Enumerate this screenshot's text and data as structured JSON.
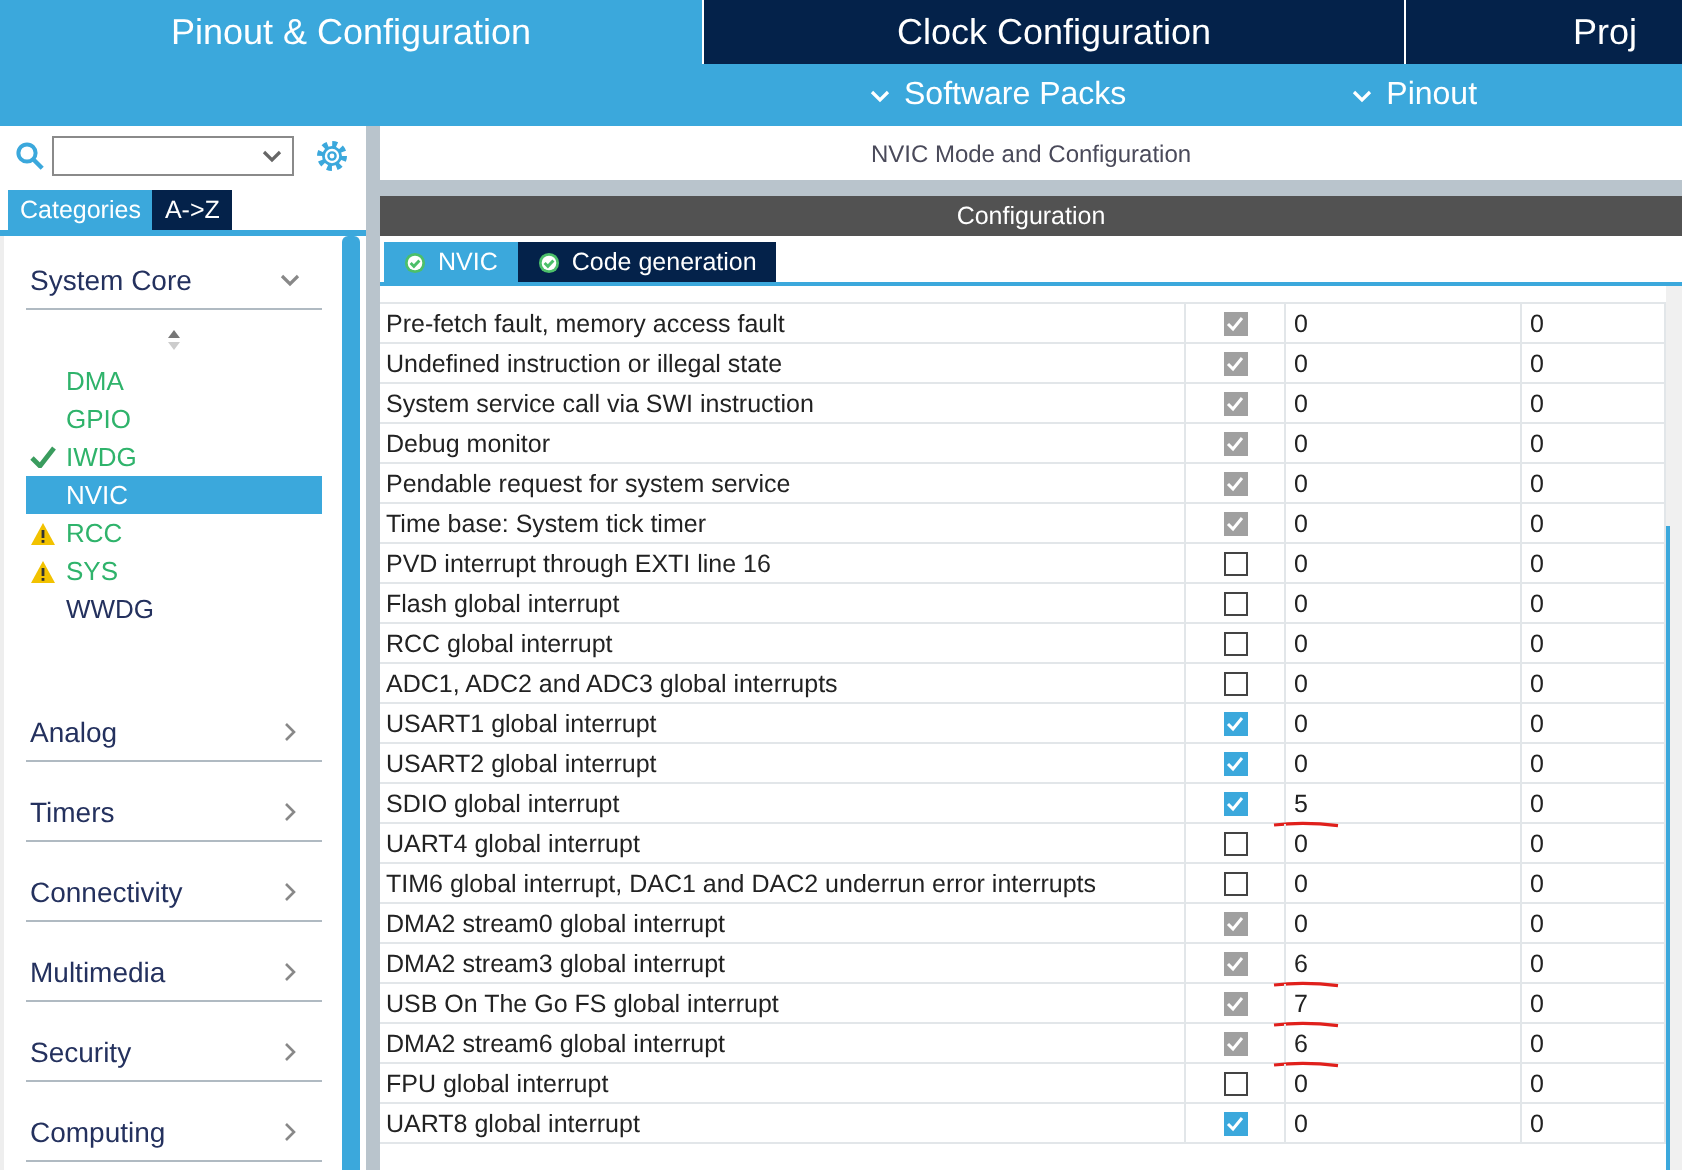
{
  "main_tabs": [
    {
      "label": "Pinout & Configuration",
      "selected": true
    },
    {
      "label": "Clock Configuration",
      "selected": false
    },
    {
      "label": "Proj",
      "selected": false
    }
  ],
  "sub_menu": [
    {
      "label": "Software Packs"
    },
    {
      "label": "Pinout"
    }
  ],
  "sidebar": {
    "category_tabs": [
      {
        "label": "Categories",
        "selected": true
      },
      {
        "label": "A->Z",
        "selected": false
      }
    ],
    "categories": [
      {
        "label": "System Core",
        "expanded": true,
        "items": [
          {
            "label": "DMA",
            "configured": true,
            "kind": "plain",
            "selected": false
          },
          {
            "label": "GPIO",
            "configured": true,
            "kind": "plain",
            "selected": false
          },
          {
            "label": "IWDG",
            "configured": true,
            "kind": "ok",
            "selected": false
          },
          {
            "label": "NVIC",
            "configured": true,
            "kind": "plain",
            "selected": true
          },
          {
            "label": "RCC",
            "configured": true,
            "kind": "warning",
            "selected": false
          },
          {
            "label": "SYS",
            "configured": true,
            "kind": "warning",
            "selected": false
          },
          {
            "label": "WWDG",
            "configured": false,
            "kind": "plain",
            "selected": false
          }
        ]
      },
      {
        "label": "Analog",
        "expanded": false
      },
      {
        "label": "Timers",
        "expanded": false
      },
      {
        "label": "Connectivity",
        "expanded": false
      },
      {
        "label": "Multimedia",
        "expanded": false
      },
      {
        "label": "Security",
        "expanded": false
      },
      {
        "label": "Computing",
        "expanded": false
      }
    ]
  },
  "panel": {
    "title": "NVIC Mode and Configuration",
    "section": "Configuration",
    "tabs": [
      {
        "label": "NVIC",
        "selected": true
      },
      {
        "label": "Code generation",
        "selected": false
      }
    ],
    "rows": [
      {
        "name": "Pre-fetch fault, memory access fault",
        "checked": true,
        "disabled": true,
        "column_3": "0",
        "column_4": "0",
        "annotated": false
      },
      {
        "name": "Undefined instruction or illegal state",
        "checked": true,
        "disabled": true,
        "column_3": "0",
        "column_4": "0",
        "annotated": false
      },
      {
        "name": "System service call via SWI instruction",
        "checked": true,
        "disabled": true,
        "column_3": "0",
        "column_4": "0",
        "annotated": false
      },
      {
        "name": "Debug monitor",
        "checked": true,
        "disabled": true,
        "column_3": "0",
        "column_4": "0",
        "annotated": false
      },
      {
        "name": "Pendable request for system service",
        "checked": true,
        "disabled": true,
        "column_3": "0",
        "column_4": "0",
        "annotated": false
      },
      {
        "name": "Time base: System tick timer",
        "checked": true,
        "disabled": true,
        "column_3": "0",
        "column_4": "0",
        "annotated": false
      },
      {
        "name": "PVD interrupt through EXTI line 16",
        "checked": false,
        "disabled": false,
        "column_3": "0",
        "column_4": "0",
        "annotated": false
      },
      {
        "name": "Flash global interrupt",
        "checked": false,
        "disabled": false,
        "column_3": "0",
        "column_4": "0",
        "annotated": false
      },
      {
        "name": "RCC global interrupt",
        "checked": false,
        "disabled": false,
        "column_3": "0",
        "column_4": "0",
        "annotated": false
      },
      {
        "name": "ADC1, ADC2 and ADC3 global interrupts",
        "checked": false,
        "disabled": false,
        "column_3": "0",
        "column_4": "0",
        "annotated": false
      },
      {
        "name": "USART1 global interrupt",
        "checked": true,
        "disabled": false,
        "column_3": "0",
        "column_4": "0",
        "annotated": false
      },
      {
        "name": "USART2 global interrupt",
        "checked": true,
        "disabled": false,
        "column_3": "0",
        "column_4": "0",
        "annotated": false
      },
      {
        "name": "SDIO global interrupt",
        "checked": true,
        "disabled": false,
        "column_3": "5",
        "column_4": "0",
        "annotated": true
      },
      {
        "name": "UART4 global interrupt",
        "checked": false,
        "disabled": false,
        "column_3": "0",
        "column_4": "0",
        "annotated": false
      },
      {
        "name": "TIM6 global interrupt, DAC1 and DAC2 underrun error interrupts",
        "checked": false,
        "disabled": false,
        "column_3": "0",
        "column_4": "0",
        "annotated": false
      },
      {
        "name": "DMA2 stream0 global interrupt",
        "checked": true,
        "disabled": true,
        "column_3": "0",
        "column_4": "0",
        "annotated": false
      },
      {
        "name": "DMA2 stream3 global interrupt",
        "checked": true,
        "disabled": true,
        "column_3": "6",
        "column_4": "0",
        "annotated": true
      },
      {
        "name": "USB On The Go FS global interrupt",
        "checked": true,
        "disabled": true,
        "column_3": "7",
        "column_4": "0",
        "annotated": true
      },
      {
        "name": "DMA2 stream6 global interrupt",
        "checked": true,
        "disabled": true,
        "column_3": "6",
        "column_4": "0",
        "annotated": true
      },
      {
        "name": "FPU global interrupt",
        "checked": false,
        "disabled": false,
        "column_3": "0",
        "column_4": "0",
        "annotated": false
      },
      {
        "name": "UART8 global interrupt",
        "checked": true,
        "disabled": false,
        "column_3": "0",
        "column_4": "0",
        "annotated": false
      }
    ]
  }
}
